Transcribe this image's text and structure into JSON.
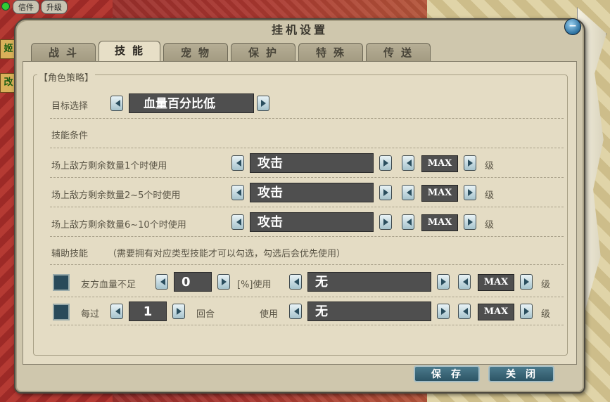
{
  "hud": {
    "mail_label": "信件",
    "upgrade_label": "升级",
    "side_tab_1": "姬",
    "side_tab_2": "改"
  },
  "window": {
    "title": "挂机设置"
  },
  "tabs": [
    {
      "label": "战斗",
      "active": false
    },
    {
      "label": "技能",
      "active": true
    },
    {
      "label": "宠物",
      "active": false
    },
    {
      "label": "保护",
      "active": false
    },
    {
      "label": "特殊",
      "active": false
    },
    {
      "label": "传送",
      "active": false
    }
  ],
  "strategy": {
    "legend": "【角色策略】",
    "target_label": "目标选择",
    "target_value": "血量百分比低",
    "skill_condition_label": "技能条件",
    "rows": [
      {
        "label": "场上敌方剩余数量1个时使用",
        "skill": "攻击",
        "level": "MAX",
        "unit": "级"
      },
      {
        "label": "场上敌方剩余数量2~5个时使用",
        "skill": "攻击",
        "level": "MAX",
        "unit": "级"
      },
      {
        "label": "场上敌方剩余数量6~10个时使用",
        "skill": "攻击",
        "level": "MAX",
        "unit": "级"
      }
    ],
    "aux_label": "辅助技能",
    "aux_note": "（需要拥有对应类型技能才可以勾选，勾选后会优先使用）",
    "aux_rows": [
      {
        "prefix": "友方血量不足",
        "value": "0",
        "suffix": "[%]使用",
        "skill": "无",
        "level": "MAX",
        "unit": "级"
      },
      {
        "prefix": "每过",
        "value": "1",
        "suffix": "回合",
        "use_label": "使用",
        "skill": "无",
        "level": "MAX",
        "unit": "级"
      }
    ]
  },
  "footer": {
    "save_label": "保存",
    "close_label": "关闭"
  },
  "colors": {
    "panel": "#e4dcc4",
    "button": "#2d5566",
    "value_box": "#4f4f4f"
  }
}
